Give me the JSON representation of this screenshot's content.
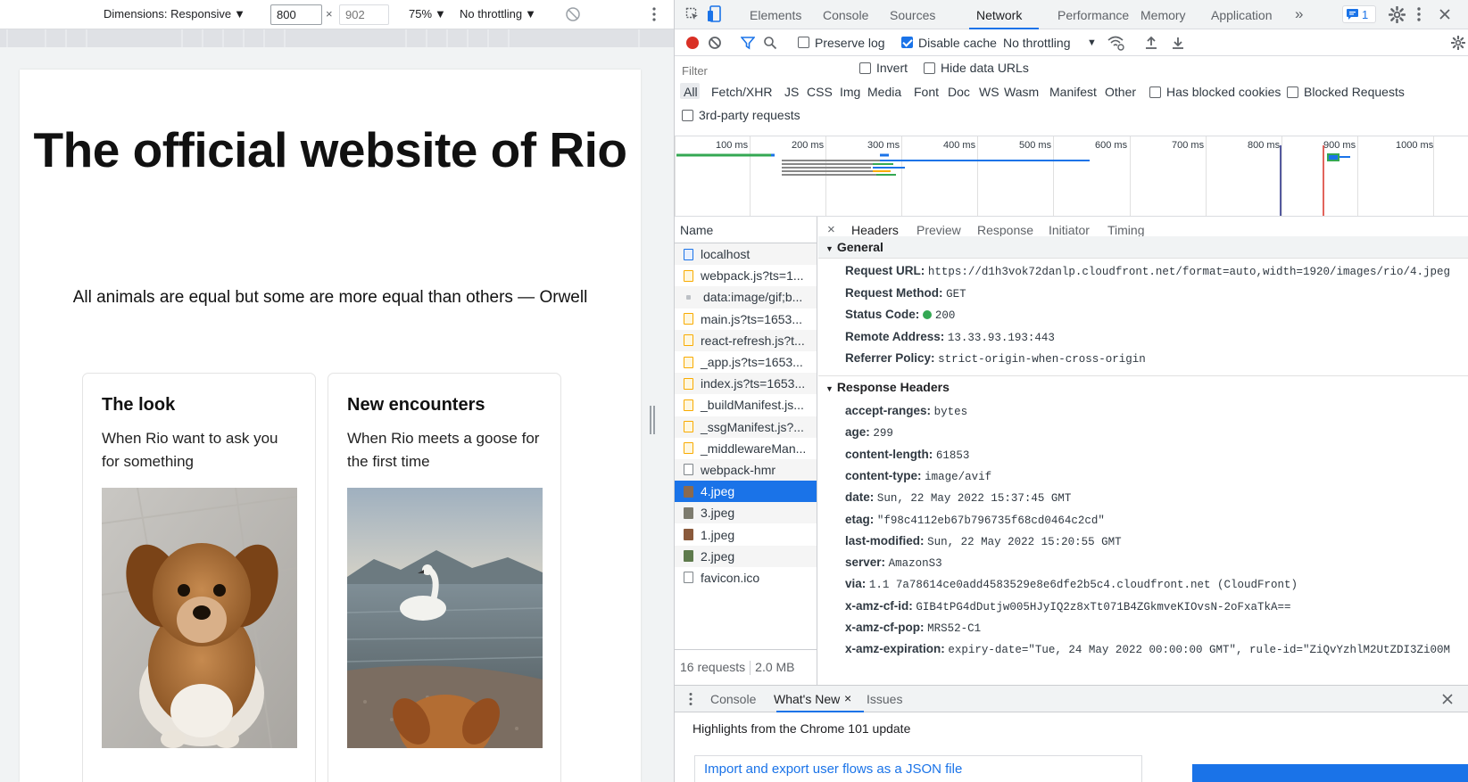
{
  "device_toolbar": {
    "dimensions_label": "Dimensions: Responsive",
    "width_value": "800",
    "times": "×",
    "height_placeholder": "902",
    "zoom": "75%",
    "throttling": "No throttling"
  },
  "page": {
    "title": "The official website of Rio",
    "quote": "All animals are equal but some are more equal than others — Orwell",
    "cards": [
      {
        "title": "The look",
        "text": "When Rio want to ask you for something"
      },
      {
        "title": "New encounters",
        "text": "When Rio meets a goose for the first time"
      }
    ]
  },
  "devtools": {
    "tabs": [
      "Elements",
      "Console",
      "Sources",
      "Network",
      "Performance",
      "Memory",
      "Application"
    ],
    "more_tabs": "»",
    "active_tab": "Network",
    "issues_count": "1",
    "toolbar": {
      "preserve_log": "Preserve log",
      "disable_cache": "Disable cache",
      "throttling": "No throttling"
    },
    "filter": {
      "placeholder": "Filter",
      "invert": "Invert",
      "hide_data_urls": "Hide data URLs",
      "types": [
        "All",
        "Fetch/XHR",
        "JS",
        "CSS",
        "Img",
        "Media",
        "Font",
        "Doc",
        "WS",
        "Wasm",
        "Manifest",
        "Other"
      ],
      "has_blocked_cookies": "Has blocked cookies",
      "blocked_requests": "Blocked Requests",
      "third_party": "3rd-party requests"
    },
    "timeline_ticks": [
      "100 ms",
      "200 ms",
      "300 ms",
      "400 ms",
      "500 ms",
      "600 ms",
      "700 ms",
      "800 ms",
      "900 ms",
      "1000 ms"
    ],
    "name_header": "Name",
    "requests": [
      {
        "name": "localhost",
        "type": "doc"
      },
      {
        "name": "webpack.js?ts=1...",
        "type": "js"
      },
      {
        "name": "data:image/gif;b...",
        "type": "gif"
      },
      {
        "name": "main.js?ts=1653...",
        "type": "js"
      },
      {
        "name": "react-refresh.js?t...",
        "type": "js"
      },
      {
        "name": "_app.js?ts=1653...",
        "type": "js"
      },
      {
        "name": "index.js?ts=1653...",
        "type": "js"
      },
      {
        "name": "_buildManifest.js...",
        "type": "js"
      },
      {
        "name": "_ssgManifest.js?...",
        "type": "js"
      },
      {
        "name": "_middlewareMan...",
        "type": "js"
      },
      {
        "name": "webpack-hmr",
        "type": "blank"
      },
      {
        "name": "4.jpeg",
        "type": "img",
        "color": "#8b6a4e"
      },
      {
        "name": "3.jpeg",
        "type": "img",
        "color": "#7d7b6e"
      },
      {
        "name": "1.jpeg",
        "type": "img",
        "color": "#8a5a3c"
      },
      {
        "name": "2.jpeg",
        "type": "img",
        "color": "#5e7a4c"
      },
      {
        "name": "favicon.ico",
        "type": "blank"
      }
    ],
    "selected_request": "4.jpeg",
    "summary_requests": "16 requests",
    "summary_size": "2.0 MB",
    "detail_tabs": [
      "Headers",
      "Preview",
      "Response",
      "Initiator",
      "Timing"
    ],
    "close": "×",
    "general_title": "General",
    "general": [
      {
        "k": "Request URL:",
        "v": "https://d1h3vok72danlp.cloudfront.net/format=auto,width=1920/images/rio/4.jpeg"
      },
      {
        "k": "Request Method:",
        "v": "GET"
      },
      {
        "k": "Status Code:",
        "v": "200"
      },
      {
        "k": "Remote Address:",
        "v": "13.33.93.193:443"
      },
      {
        "k": "Referrer Policy:",
        "v": "strict-origin-when-cross-origin"
      }
    ],
    "response_title": "Response Headers",
    "response_headers": [
      {
        "k": "accept-ranges:",
        "v": "bytes"
      },
      {
        "k": "age:",
        "v": "299"
      },
      {
        "k": "content-length:",
        "v": "61853"
      },
      {
        "k": "content-type:",
        "v": "image/avif"
      },
      {
        "k": "date:",
        "v": "Sun, 22 May 2022 15:37:45 GMT"
      },
      {
        "k": "etag:",
        "v": "\"f98c4112eb67b796735f68cd0464c2cd\""
      },
      {
        "k": "last-modified:",
        "v": "Sun, 22 May 2022 15:20:55 GMT"
      },
      {
        "k": "server:",
        "v": "AmazonS3"
      },
      {
        "k": "via:",
        "v": "1.1 7a78614ce0add4583529e8e6dfe2b5c4.cloudfront.net (CloudFront)"
      },
      {
        "k": "x-amz-cf-id:",
        "v": "GIB4tPG4dDutjw005HJyIQ2z8xTt071B4ZGkmveKIOvsN-2oFxaTkA=="
      },
      {
        "k": "x-amz-cf-pop:",
        "v": "MRS52-C1"
      },
      {
        "k": "x-amz-expiration:",
        "v": "expiry-date=\"Tue, 24 May 2022 00:00:00 GMT\", rule-id=\"ZiQvYzhlM2UtZDI3Zi00M"
      }
    ],
    "drawer": {
      "tabs": [
        "Console",
        "What's New",
        "Issues"
      ],
      "active": "What's New",
      "headline": "Highlights from the Chrome 101 update",
      "card_link": "Import and export user flows as a JSON file"
    },
    "colors": {
      "accent": "#1a73e8",
      "record": "#d93025",
      "status_ok": "#34a853"
    }
  }
}
